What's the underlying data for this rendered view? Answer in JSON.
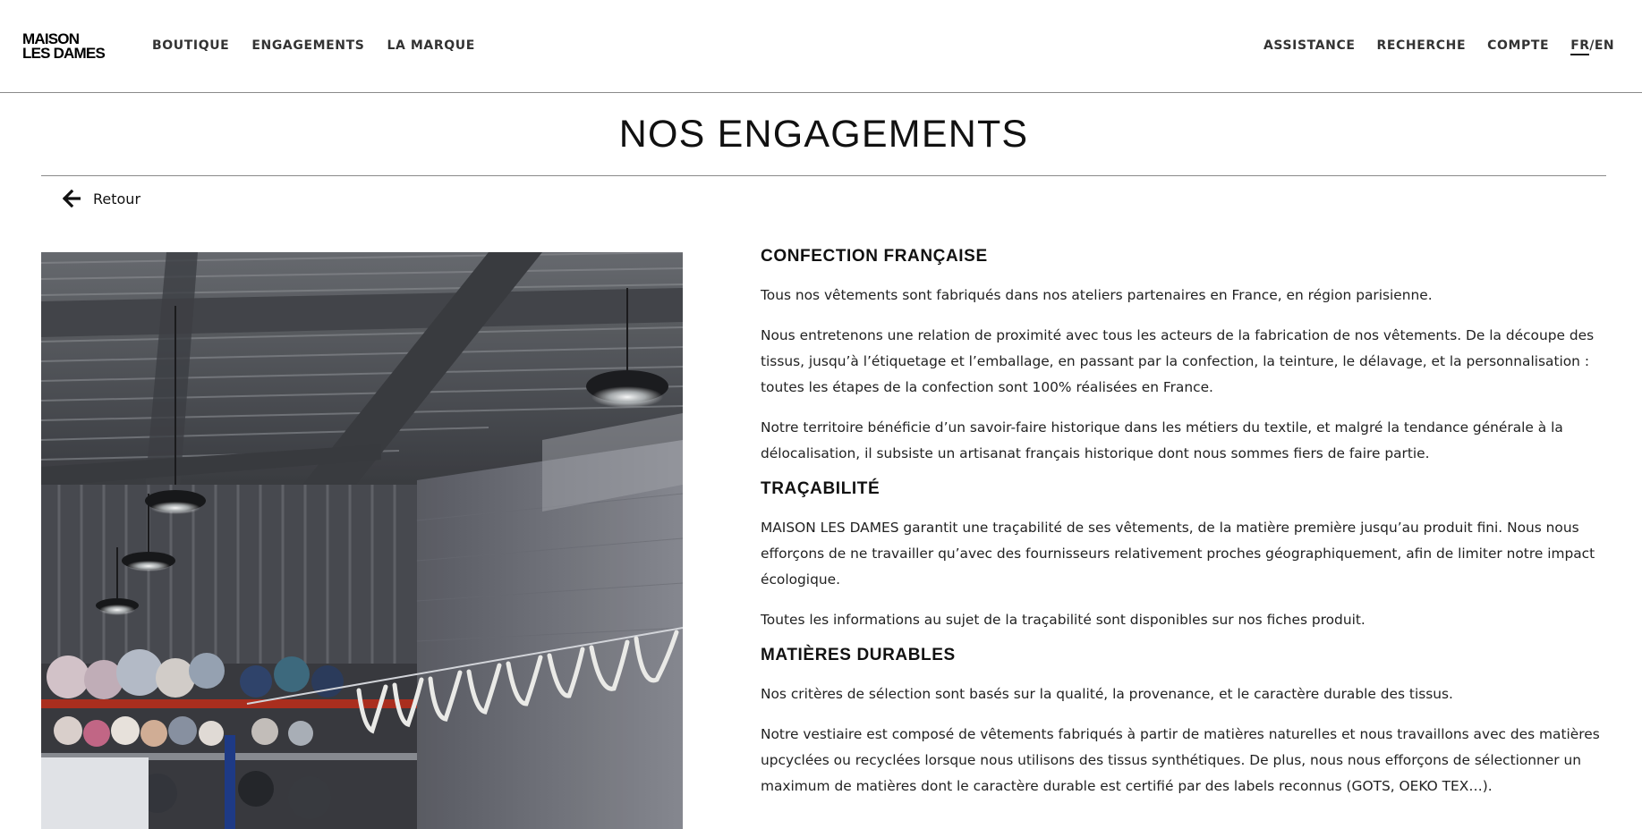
{
  "header": {
    "logo_line1": "MAISON",
    "logo_line2": "LES DAMES",
    "nav_left": [
      "BOUTIQUE",
      "ENGAGEMENTS",
      "LA MARQUE"
    ],
    "nav_right": [
      "ASSISTANCE",
      "RECHERCHE",
      "COMPTE"
    ],
    "lang_active": "FR",
    "lang_separator": "/",
    "lang_other": "EN"
  },
  "page": {
    "title": "NOS ENGAGEMENTS",
    "back_label": "Retour"
  },
  "sections": [
    {
      "heading": "CONFECTION FRANÇAISE",
      "paragraphs": [
        "Tous nos vêtements sont fabriqués dans nos ateliers partenaires en France, en région parisienne.",
        "Nous entretenons une relation de proximité avec tous les acteurs de la fabrication de nos vêtements. De la découpe des tissus, jusqu’à l’étiquetage et l’emballage, en passant par la confection, la teinture, le délavage, et la personnalisation : toutes les étapes de la confection sont 100% réalisées en France.",
        "Notre territoire bénéficie d’un savoir-faire historique dans les métiers du textile, et malgré la tendance générale à la délocalisation, il subsiste un artisanat français historique dont nous sommes fiers de faire partie."
      ]
    },
    {
      "heading": "TRAÇABILITÉ",
      "paragraphs": [
        "MAISON LES DAMES garantit une traçabilité de ses vêtements, de la matière première jusqu’au produit fini. Nous nous efforçons de ne travailler qu’avec des fournisseurs relativement proches géographiquement, afin de limiter notre impact écologique.",
        "Toutes les informations au sujet de la traçabilité sont disponibles sur nos fiches produit."
      ]
    },
    {
      "heading": "MATIÈRES DURABLES",
      "paragraphs": [
        "Nos critères de sélection sont basés sur la qualité, la provenance, et le caractère durable des tissus.",
        "Notre vestiaire est composé de vêtements fabriqués à partir de matières naturelles et nous travaillons avec des matières upcyclées ou recyclées lorsque nous utilisons des tissus synthétiques. De plus, nous nous efforçons de sélectionner un maximum de matières dont le caractère durable est certifié par des labels reconnus (GOTS, OEKO TEX…)."
      ]
    }
  ]
}
